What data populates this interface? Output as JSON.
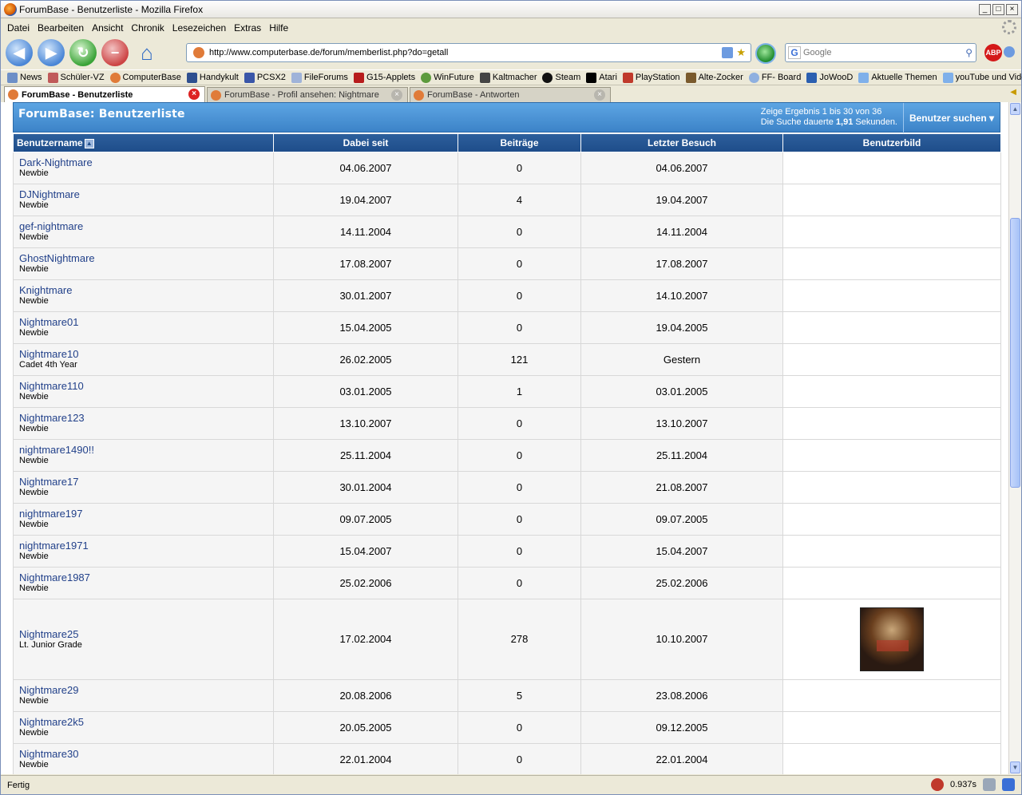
{
  "window": {
    "title": "ForumBase - Benutzerliste - Mozilla Firefox"
  },
  "menu": [
    "Datei",
    "Bearbeiten",
    "Ansicht",
    "Chronik",
    "Lesezeichen",
    "Extras",
    "Hilfe"
  ],
  "address": {
    "url": "http://www.computerbase.de/forum/memberlist.php?do=getall"
  },
  "search": {
    "placeholder": "Google"
  },
  "bookmarks": [
    "News",
    "Schüler-VZ",
    "ComputerBase",
    "Handykult",
    "PCSX2",
    "FileForums",
    "G15-Applets",
    "WinFuture",
    "Kaltmacher",
    "Steam",
    "Atari",
    "PlayStation",
    "Alte-Zocker",
    "FF- Board",
    "JoWooD",
    "Aktuelle Themen",
    "youTube und Videos"
  ],
  "tabs": [
    {
      "label": "ForumBase - Benutzerliste",
      "active": true
    },
    {
      "label": "ForumBase - Profil ansehen: Nightmare",
      "active": false
    },
    {
      "label": "ForumBase - Antworten",
      "active": false
    }
  ],
  "page": {
    "title": "ForumBase: Benutzerliste",
    "info_line1": "Zeige Ergebnis 1 bis 30 von 36",
    "info_line2_pre": "Die Suche dauerte",
    "info_time": "1,91",
    "info_line2_post": "Sekunden.",
    "search_button": "Benutzer suchen"
  },
  "columns": [
    "Benutzername",
    "Dabei seit",
    "Beiträge",
    "Letzter Besuch",
    "Benutzerbild"
  ],
  "rows": [
    {
      "name": "Dark-Nightmare",
      "rank": "Newbie",
      "since": "04.06.2007",
      "posts": "0",
      "last": "04.06.2007",
      "avatar": false
    },
    {
      "name": "DJNightmare",
      "rank": "Newbie",
      "since": "19.04.2007",
      "posts": "4",
      "last": "19.04.2007",
      "avatar": false
    },
    {
      "name": "gef-nightmare",
      "rank": "Newbie",
      "since": "14.11.2004",
      "posts": "0",
      "last": "14.11.2004",
      "avatar": false
    },
    {
      "name": "GhostNightmare",
      "rank": "Newbie",
      "since": "17.08.2007",
      "posts": "0",
      "last": "17.08.2007",
      "avatar": false
    },
    {
      "name": "Knightmare",
      "rank": "Newbie",
      "since": "30.01.2007",
      "posts": "0",
      "last": "14.10.2007",
      "avatar": false
    },
    {
      "name": "Nightmare01",
      "rank": "Newbie",
      "since": "15.04.2005",
      "posts": "0",
      "last": "19.04.2005",
      "avatar": false
    },
    {
      "name": "Nightmare10",
      "rank": "Cadet 4th Year",
      "since": "26.02.2005",
      "posts": "121",
      "last": "Gestern",
      "avatar": false
    },
    {
      "name": "Nightmare110",
      "rank": "Newbie",
      "since": "03.01.2005",
      "posts": "1",
      "last": "03.01.2005",
      "avatar": false
    },
    {
      "name": "Nightmare123",
      "rank": "Newbie",
      "since": "13.10.2007",
      "posts": "0",
      "last": "13.10.2007",
      "avatar": false
    },
    {
      "name": "nightmare1490!!",
      "rank": "Newbie",
      "since": "25.11.2004",
      "posts": "0",
      "last": "25.11.2004",
      "avatar": false
    },
    {
      "name": "Nightmare17",
      "rank": "Newbie",
      "since": "30.01.2004",
      "posts": "0",
      "last": "21.08.2007",
      "avatar": false
    },
    {
      "name": "nightmare197",
      "rank": "Newbie",
      "since": "09.07.2005",
      "posts": "0",
      "last": "09.07.2005",
      "avatar": false
    },
    {
      "name": "nightmare1971",
      "rank": "Newbie",
      "since": "15.04.2007",
      "posts": "0",
      "last": "15.04.2007",
      "avatar": false
    },
    {
      "name": "Nightmare1987",
      "rank": "Newbie",
      "since": "25.02.2006",
      "posts": "0",
      "last": "25.02.2006",
      "avatar": false
    },
    {
      "name": "Nightmare25",
      "rank": "Lt. Junior Grade",
      "since": "17.02.2004",
      "posts": "278",
      "last": "10.10.2007",
      "avatar": true
    },
    {
      "name": "Nightmare29",
      "rank": "Newbie",
      "since": "20.08.2006",
      "posts": "5",
      "last": "23.08.2006",
      "avatar": false
    },
    {
      "name": "Nightmare2k5",
      "rank": "Newbie",
      "since": "20.05.2005",
      "posts": "0",
      "last": "09.12.2005",
      "avatar": false
    },
    {
      "name": "Nightmare30",
      "rank": "Newbie",
      "since": "22.01.2004",
      "posts": "0",
      "last": "22.01.2004",
      "avatar": false
    }
  ],
  "status": {
    "text": "Fertig",
    "time": "0.937s"
  }
}
